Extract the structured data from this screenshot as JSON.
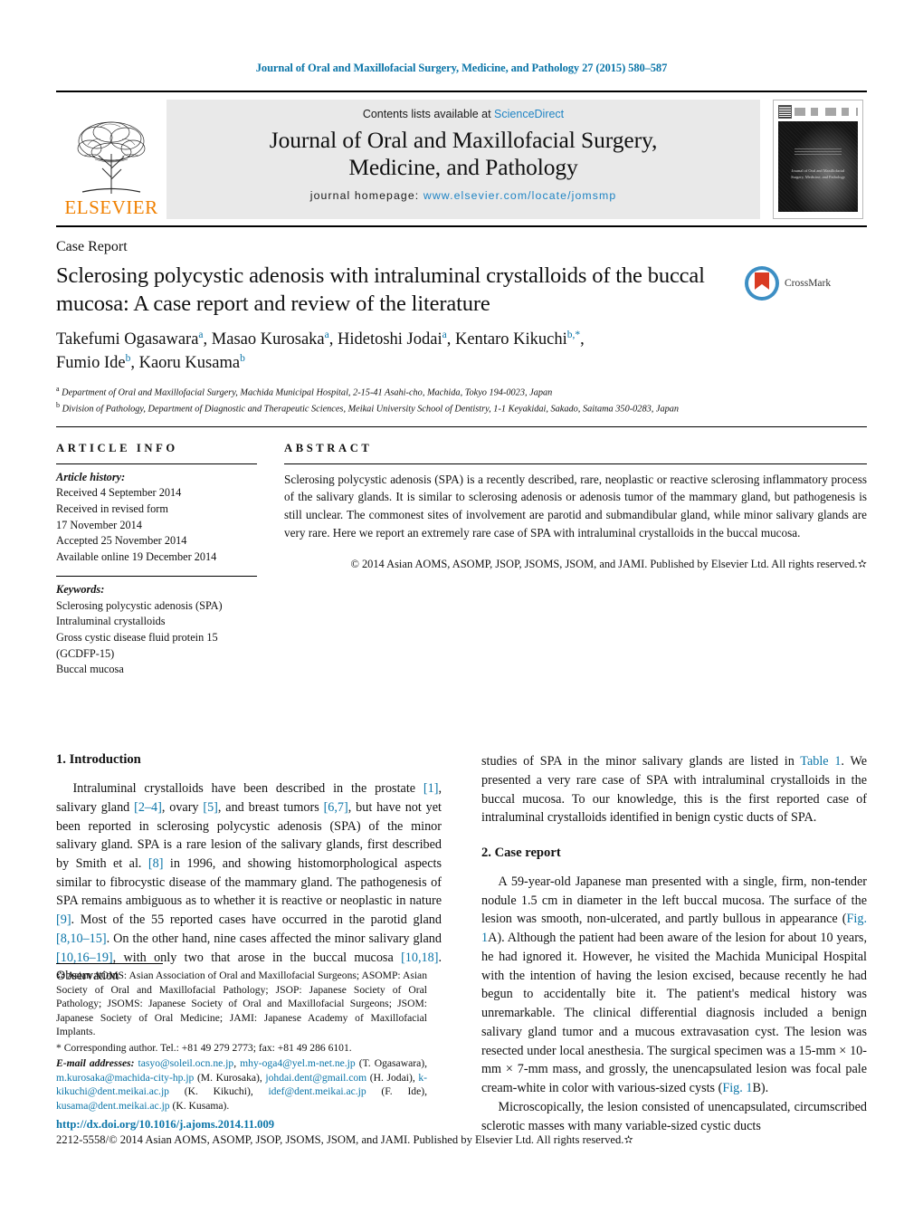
{
  "running_head": "Journal of Oral and Maxillofacial Surgery, Medicine, and Pathology 27 (2015) 580–587",
  "masthead": {
    "publisher": "ELSEVIER",
    "contents_prefix": "Contents lists available at ",
    "contents_link": "ScienceDirect",
    "journal_title_line1": "Journal of Oral and Maxillofacial Surgery,",
    "journal_title_line2": "Medicine, and Pathology",
    "homepage_label": "journal homepage:",
    "homepage_url": "www.elsevier.com/locate/jomsmp",
    "cover_caption_line1": "Journal of Oral and Maxillofacial",
    "cover_caption_line2": "Surgery, Medicine, and Pathology",
    "link_color": "#1f84c4",
    "elsevier_orange": "#f08000"
  },
  "article": {
    "type": "Case Report",
    "title": "Sclerosing polycystic adenosis with intraluminal crystalloids of the buccal mucosa: A case report and review of the literature",
    "crossmark_label": "CrossMark",
    "authors_line1": "Takefumi Ogasawara",
    "authors_line1_b": ", Masao Kurosaka",
    "authors_line1_c": ", Hidetoshi Jodai",
    "authors_line1_d": ", Kentaro Kikuchi",
    "authors_line2": "Fumio Ide",
    "authors_line2_b": ", Kaoru Kusama",
    "affiliation_a": "Department of Oral and Maxillofacial Surgery, Machida Municipal Hospital, 2-15-41 Asahi-cho, Machida, Tokyo 194-0023, Japan",
    "affiliation_b": "Division of Pathology, Department of Diagnostic and Therapeutic Sciences, Meikai University School of Dentistry, 1-1 Keyakidai, Sakado, Saitama 350-0283, Japan"
  },
  "info": {
    "heading": "ARTICLE INFO",
    "history_label": "Article history:",
    "history": [
      "Received 4 September 2014",
      "Received in revised form",
      "17 November 2014",
      "Accepted 25 November 2014",
      "Available online 19 December 2014"
    ],
    "keywords_label": "Keywords:",
    "keywords": [
      "Sclerosing polycystic adenosis (SPA)",
      "Intraluminal crystalloids",
      "Gross cystic disease fluid protein 15",
      "(GCDFP-15)",
      "Buccal mucosa"
    ]
  },
  "abstract": {
    "heading": "ABSTRACT",
    "text": "Sclerosing polycystic adenosis (SPA) is a recently described, rare, neoplastic or reactive sclerosing inflammatory process of the salivary glands. It is similar to sclerosing adenosis or adenosis tumor of the mammary gland, but pathogenesis is still unclear. The commonest sites of involvement are parotid and submandibular gland, while minor salivary glands are very rare. Here we report an extremely rare case of SPA with intraluminal crystalloids in the buccal mucosa.",
    "copyright": "© 2014 Asian AOMS, ASOMP, JSOP, JSOMS, JSOM, and JAMI. Published by Elsevier Ltd. All rights reserved.✫"
  },
  "body": {
    "left": {
      "section1_title": "1.  Introduction",
      "p1_a": "Intraluminal crystalloids have been described in the prostate ",
      "p1_r1": "[1]",
      "p1_b": ", salivary gland ",
      "p1_r2": "[2–4]",
      "p1_c": ", ovary ",
      "p1_r3": "[5]",
      "p1_d": ", and breast tumors ",
      "p1_r4": "[6,7]",
      "p1_e": ", but have not yet been reported in sclerosing polycystic adenosis (SPA) of the minor salivary gland. SPA is a rare lesion of the salivary glands, first described by Smith et al. ",
      "p1_r5": "[8]",
      "p1_f": " in 1996, and showing histomorphological aspects similar to fibrocystic disease of the mammary gland. The pathogenesis of SPA remains ambiguous as to whether it is reactive or neoplastic in nature ",
      "p1_r6": "[9]",
      "p1_g": ". Most of the 55 reported cases have occurred in the parotid gland ",
      "p1_r7": "[8,10–15]",
      "p1_h": ". On the other hand, nine cases affected the minor salivary gland ",
      "p1_r8": "[10,16–19]",
      "p1_i": ", with only two that arose in the buccal mucosa ",
      "p1_r9": "[10,18]",
      "p1_j": ". Observation"
    },
    "right": {
      "p1_a": "studies of SPA in the minor salivary glands are listed in ",
      "p1_r1": "Table 1",
      "p1_b": ". We presented a very rare case of SPA with intraluminal crystalloids in the buccal mucosa. To our knowledge, this is the first reported case of intraluminal crystalloids identified in benign cystic ducts of SPA.",
      "section2_title": "2.  Case report",
      "p2_a": "A 59-year-old Japanese man presented with a single, firm, non-tender nodule 1.5 cm in diameter in the left buccal mucosa. The surface of the lesion was smooth, non-ulcerated, and partly bullous in appearance (",
      "p2_r1": "Fig. 1",
      "p2_b": "A). Although the patient had been aware of the lesion for about 10 years, he had ignored it. However, he visited the Machida Municipal Hospital with the intention of having the lesion excised, because recently he had begun to accidentally bite it. The patient's medical history was unremarkable. The clinical differential diagnosis included a benign salivary gland tumor and a mucous extravasation cyst. The lesion was resected under local anesthesia. The surgical specimen was a 15-mm × 10-mm × 7-mm mass, and grossly, the unencapsulated lesion was focal pale cream-white in color with various-sized cysts (",
      "p2_r2": "Fig. 1",
      "p2_c": "B).",
      "p3": "Microscopically, the lesion consisted of unencapsulated, circumscribed sclerotic masses with many variable-sized cystic ducts"
    }
  },
  "footnotes": {
    "societies": "✫ Asian AOMS: Asian Association of Oral and Maxillofacial Surgeons; ASOMP: Asian Society of Oral and Maxillofacial Pathology; JSOP: Japanese Society of Oral Pathology; JSOMS: Japanese Society of Oral and Maxillofacial Surgeons; JSOM: Japanese Society of Oral Medicine; JAMI: Japanese Academy of Maxillofacial Implants.",
    "corresponding": "* Corresponding author. Tel.: +81 49 279 2773; fax: +81 49 286 6101.",
    "email_label": "E-mail addresses:",
    "emails": [
      {
        "address": "tasyo@soleil.ocn.ne.jp",
        "owner": ""
      },
      {
        "address": "mhy-oga4@yel.m-net.ne.jp",
        "owner": "(T. Ogasawara)"
      },
      {
        "address": "m.kurosaka@machida-city-hp.jp",
        "owner": "(M. Kurosaka)"
      },
      {
        "address": "johdai.dent@gmail.com",
        "owner": "(H. Jodai)"
      },
      {
        "address": "k-kikuchi@dent.meikai.ac.jp",
        "owner": "(K. Kikuchi)"
      },
      {
        "address": "idef@dent.meikai.ac.jp",
        "owner": "(F. Ide)"
      },
      {
        "address": "kusama@dent.meikai.ac.jp",
        "owner": "(K. Kusama)"
      }
    ]
  },
  "bottom": {
    "doi": "http://dx.doi.org/10.1016/j.ajoms.2014.11.009",
    "issn_line": "2212-5558/© 2014 Asian AOMS, ASOMP, JSOP, JSOMS, JSOM, and JAMI. Published by Elsevier Ltd. All rights reserved.✫"
  }
}
